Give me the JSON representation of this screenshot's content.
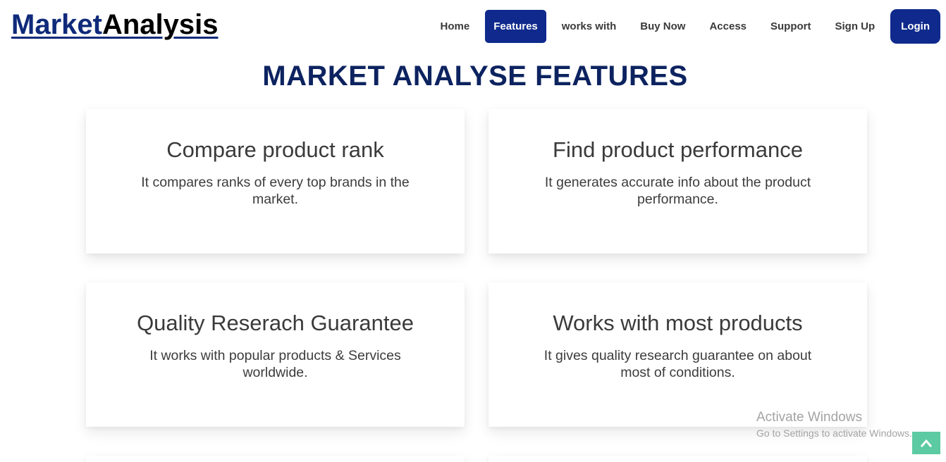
{
  "header": {
    "logo_part1": "Market",
    "logo_part2": "Analysis",
    "nav": [
      "Home",
      "Features",
      "works with",
      "Buy Now",
      "Access",
      "Support",
      "Sign Up"
    ],
    "active_nav": "Features",
    "login_label": "Login"
  },
  "main": {
    "title": "MARKET ANALYSE FEATURES",
    "cards": [
      {
        "title": "Compare product rank",
        "text": "It compares ranks of every top brands in the market."
      },
      {
        "title": "Find product performance",
        "text": "It generates accurate info about the product performance."
      },
      {
        "title": "Quality Reserach Guarantee",
        "text": "It works with popular products & Services worldwide."
      },
      {
        "title": "Works with most products",
        "text": "It gives quality research guarantee on about most of conditions."
      }
    ]
  },
  "watermark": {
    "line1": "Activate Windows",
    "line2": "Go to Settings to activate Windows."
  },
  "back_to_top_icon": "chevron-up-icon",
  "colors": {
    "brand_blue": "#0f2a8c",
    "title_blue": "#0d2360",
    "back_to_top": "#5ccaa2"
  }
}
